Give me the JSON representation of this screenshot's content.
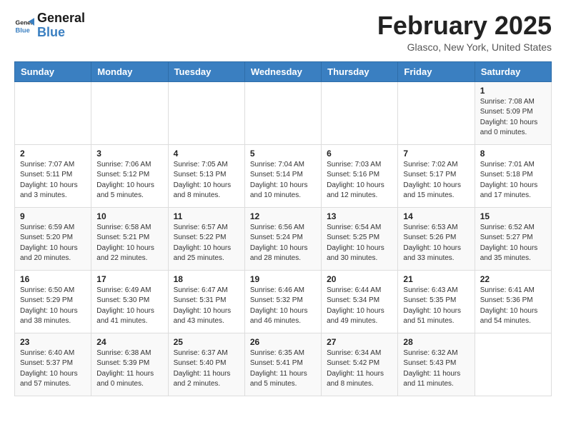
{
  "header": {
    "logo_line1": "General",
    "logo_line2": "Blue",
    "month_title": "February 2025",
    "location": "Glasco, New York, United States"
  },
  "weekdays": [
    "Sunday",
    "Monday",
    "Tuesday",
    "Wednesday",
    "Thursday",
    "Friday",
    "Saturday"
  ],
  "weeks": [
    [
      {
        "day": "",
        "info": ""
      },
      {
        "day": "",
        "info": ""
      },
      {
        "day": "",
        "info": ""
      },
      {
        "day": "",
        "info": ""
      },
      {
        "day": "",
        "info": ""
      },
      {
        "day": "",
        "info": ""
      },
      {
        "day": "1",
        "info": "Sunrise: 7:08 AM\nSunset: 5:09 PM\nDaylight: 10 hours\nand 0 minutes."
      }
    ],
    [
      {
        "day": "2",
        "info": "Sunrise: 7:07 AM\nSunset: 5:11 PM\nDaylight: 10 hours\nand 3 minutes."
      },
      {
        "day": "3",
        "info": "Sunrise: 7:06 AM\nSunset: 5:12 PM\nDaylight: 10 hours\nand 5 minutes."
      },
      {
        "day": "4",
        "info": "Sunrise: 7:05 AM\nSunset: 5:13 PM\nDaylight: 10 hours\nand 8 minutes."
      },
      {
        "day": "5",
        "info": "Sunrise: 7:04 AM\nSunset: 5:14 PM\nDaylight: 10 hours\nand 10 minutes."
      },
      {
        "day": "6",
        "info": "Sunrise: 7:03 AM\nSunset: 5:16 PM\nDaylight: 10 hours\nand 12 minutes."
      },
      {
        "day": "7",
        "info": "Sunrise: 7:02 AM\nSunset: 5:17 PM\nDaylight: 10 hours\nand 15 minutes."
      },
      {
        "day": "8",
        "info": "Sunrise: 7:01 AM\nSunset: 5:18 PM\nDaylight: 10 hours\nand 17 minutes."
      }
    ],
    [
      {
        "day": "9",
        "info": "Sunrise: 6:59 AM\nSunset: 5:20 PM\nDaylight: 10 hours\nand 20 minutes."
      },
      {
        "day": "10",
        "info": "Sunrise: 6:58 AM\nSunset: 5:21 PM\nDaylight: 10 hours\nand 22 minutes."
      },
      {
        "day": "11",
        "info": "Sunrise: 6:57 AM\nSunset: 5:22 PM\nDaylight: 10 hours\nand 25 minutes."
      },
      {
        "day": "12",
        "info": "Sunrise: 6:56 AM\nSunset: 5:24 PM\nDaylight: 10 hours\nand 28 minutes."
      },
      {
        "day": "13",
        "info": "Sunrise: 6:54 AM\nSunset: 5:25 PM\nDaylight: 10 hours\nand 30 minutes."
      },
      {
        "day": "14",
        "info": "Sunrise: 6:53 AM\nSunset: 5:26 PM\nDaylight: 10 hours\nand 33 minutes."
      },
      {
        "day": "15",
        "info": "Sunrise: 6:52 AM\nSunset: 5:27 PM\nDaylight: 10 hours\nand 35 minutes."
      }
    ],
    [
      {
        "day": "16",
        "info": "Sunrise: 6:50 AM\nSunset: 5:29 PM\nDaylight: 10 hours\nand 38 minutes."
      },
      {
        "day": "17",
        "info": "Sunrise: 6:49 AM\nSunset: 5:30 PM\nDaylight: 10 hours\nand 41 minutes."
      },
      {
        "day": "18",
        "info": "Sunrise: 6:47 AM\nSunset: 5:31 PM\nDaylight: 10 hours\nand 43 minutes."
      },
      {
        "day": "19",
        "info": "Sunrise: 6:46 AM\nSunset: 5:32 PM\nDaylight: 10 hours\nand 46 minutes."
      },
      {
        "day": "20",
        "info": "Sunrise: 6:44 AM\nSunset: 5:34 PM\nDaylight: 10 hours\nand 49 minutes."
      },
      {
        "day": "21",
        "info": "Sunrise: 6:43 AM\nSunset: 5:35 PM\nDaylight: 10 hours\nand 51 minutes."
      },
      {
        "day": "22",
        "info": "Sunrise: 6:41 AM\nSunset: 5:36 PM\nDaylight: 10 hours\nand 54 minutes."
      }
    ],
    [
      {
        "day": "23",
        "info": "Sunrise: 6:40 AM\nSunset: 5:37 PM\nDaylight: 10 hours\nand 57 minutes."
      },
      {
        "day": "24",
        "info": "Sunrise: 6:38 AM\nSunset: 5:39 PM\nDaylight: 11 hours\nand 0 minutes."
      },
      {
        "day": "25",
        "info": "Sunrise: 6:37 AM\nSunset: 5:40 PM\nDaylight: 11 hours\nand 2 minutes."
      },
      {
        "day": "26",
        "info": "Sunrise: 6:35 AM\nSunset: 5:41 PM\nDaylight: 11 hours\nand 5 minutes."
      },
      {
        "day": "27",
        "info": "Sunrise: 6:34 AM\nSunset: 5:42 PM\nDaylight: 11 hours\nand 8 minutes."
      },
      {
        "day": "28",
        "info": "Sunrise: 6:32 AM\nSunset: 5:43 PM\nDaylight: 11 hours\nand 11 minutes."
      },
      {
        "day": "",
        "info": ""
      }
    ]
  ]
}
